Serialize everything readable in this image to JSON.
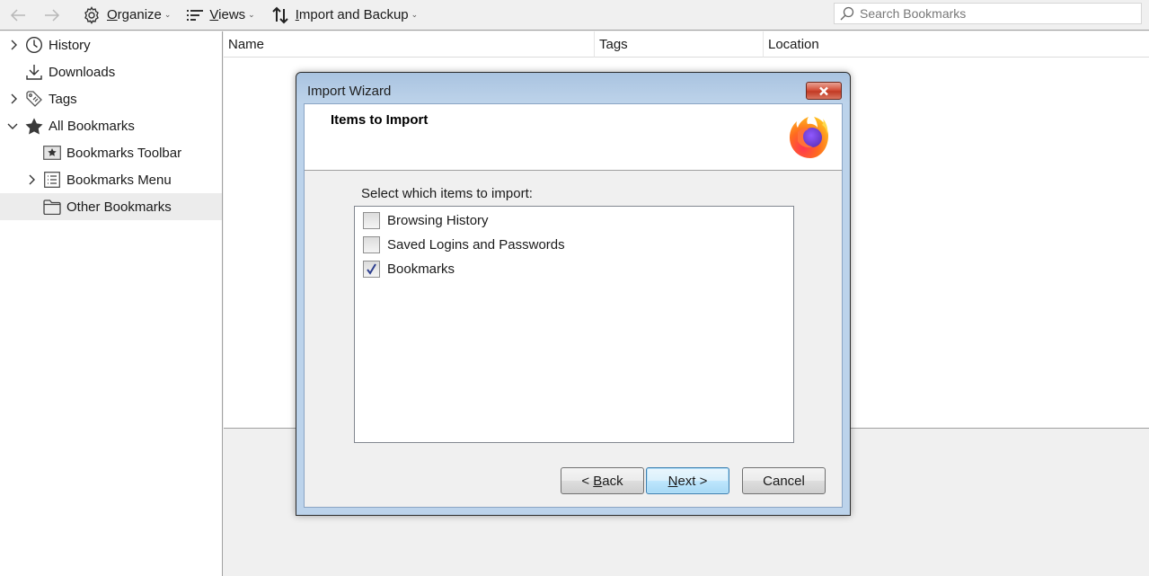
{
  "toolbar": {
    "back_icon": "arrow-left-icon",
    "forward_icon": "arrow-right-icon",
    "organize": {
      "label_prefix": "",
      "accel": "O",
      "label_rest": "rganize",
      "icon": "gear-icon"
    },
    "views": {
      "accel": "V",
      "label_rest": "iews",
      "icon": "list-lines-icon"
    },
    "import_backup": {
      "accel": "I",
      "label_rest": "mport and Backup",
      "icon": "import-export-arrows-icon"
    },
    "search_placeholder": "Search Bookmarks",
    "search_value": ""
  },
  "sidebar": {
    "items": [
      {
        "label": "History",
        "icon": "clock-icon",
        "twisty": "collapsed"
      },
      {
        "label": "Downloads",
        "icon": "download-icon",
        "twisty": "none"
      },
      {
        "label": "Tags",
        "icon": "tag-icon",
        "twisty": "collapsed"
      },
      {
        "label": "All Bookmarks",
        "icon": "star-icon",
        "twisty": "expanded"
      },
      {
        "label": "Bookmarks Toolbar",
        "icon": "bookmarks-toolbar-icon",
        "twisty": "none"
      },
      {
        "label": "Bookmarks Menu",
        "icon": "bookmarks-menu-icon",
        "twisty": "collapsed"
      },
      {
        "label": "Other Bookmarks",
        "icon": "folder-icon",
        "twisty": "none",
        "selected": true
      }
    ]
  },
  "list": {
    "columns": [
      "Name",
      "Tags",
      "Location"
    ]
  },
  "dialog": {
    "title": "Import Wizard",
    "close_label": "X",
    "heading": "Items to Import",
    "instruction": "Select which items to import:",
    "options": [
      {
        "label": "Browsing History",
        "checked": false
      },
      {
        "label": "Saved Logins and Passwords",
        "checked": false
      },
      {
        "label": "Bookmarks",
        "checked": true
      }
    ],
    "buttons": {
      "back": {
        "prefix": "< ",
        "accel": "B",
        "rest": "ack"
      },
      "next": {
        "accel": "N",
        "rest": "ext >"
      },
      "cancel": "Cancel"
    }
  }
}
